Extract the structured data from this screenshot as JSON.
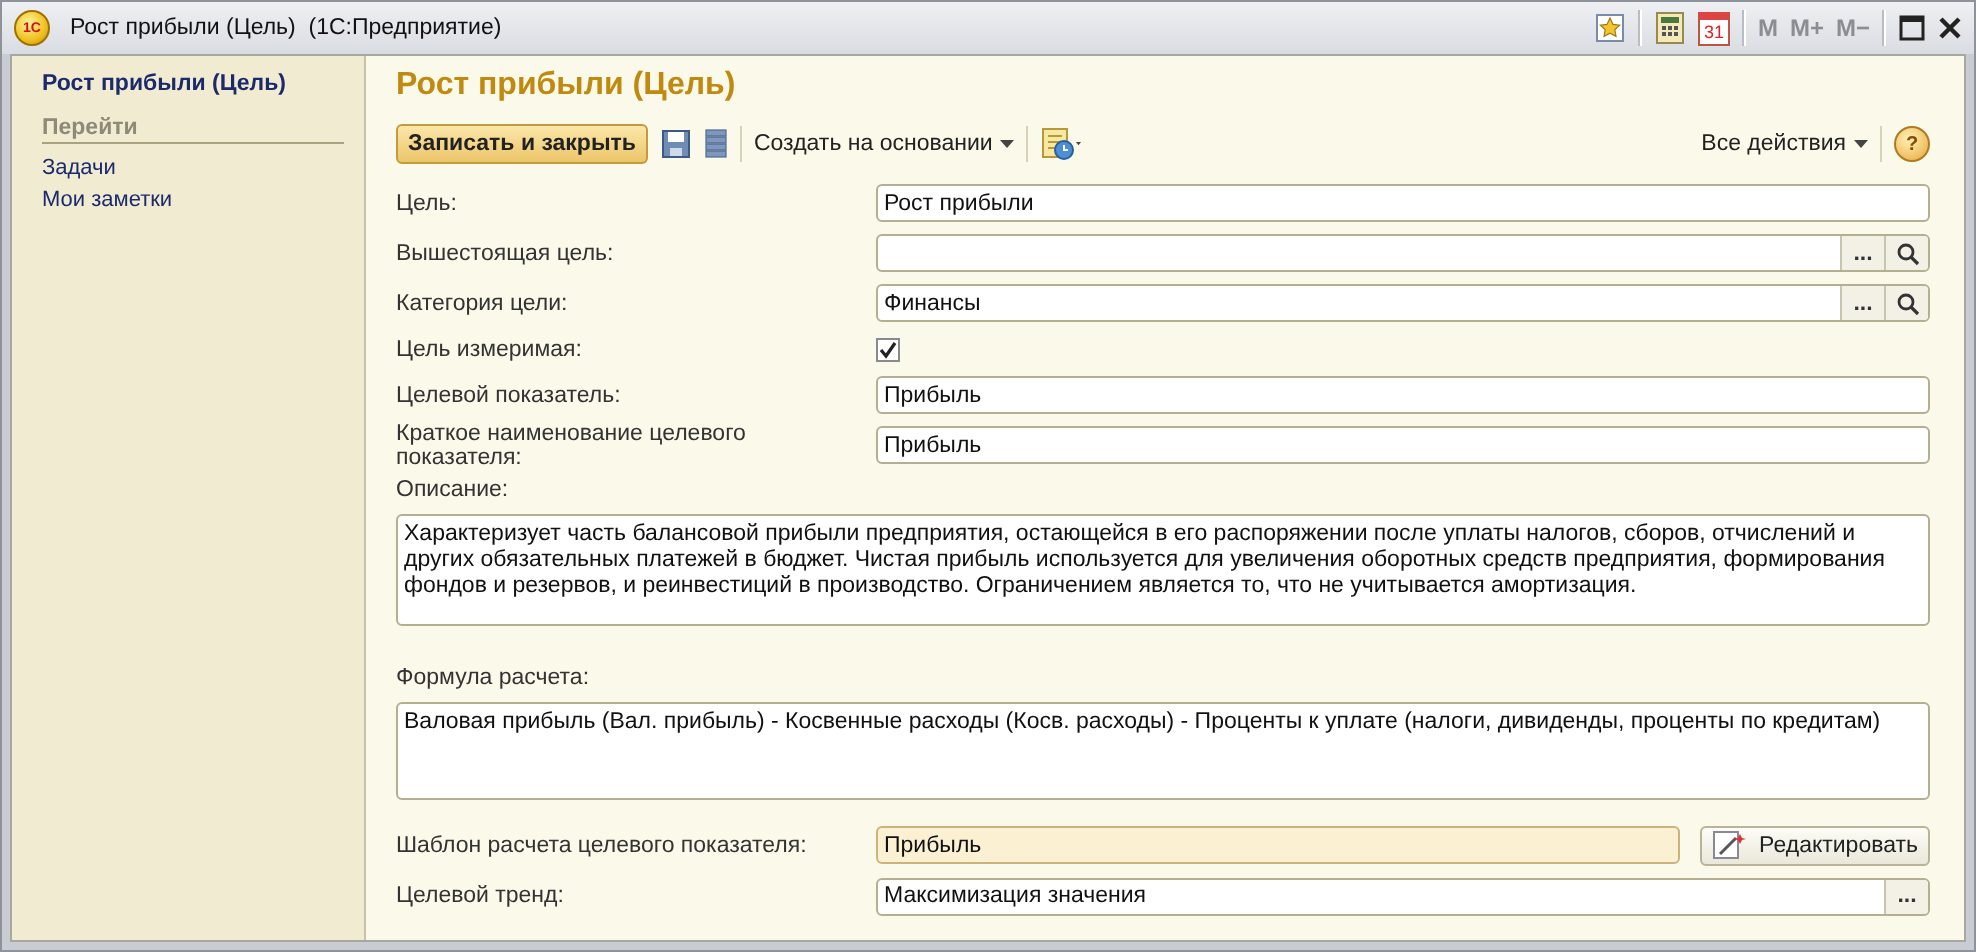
{
  "window": {
    "title": "Рост прибыли (Цель)  (1С:Предприятие)",
    "app_icon": "1С",
    "calendar_day": "31",
    "memory_buttons": [
      {
        "label": "M",
        "disabled": true
      },
      {
        "label": "M+",
        "disabled": true
      },
      {
        "label": "M−",
        "disabled": true
      }
    ]
  },
  "sidebar": {
    "title": "Рост прибыли (Цель)",
    "section": "Перейти",
    "items": [
      "Задачи",
      "Мои заметки"
    ]
  },
  "form": {
    "title": "Рост прибыли (Цель)",
    "toolbar": {
      "primary": "Записать и закрыть",
      "create_based_on": "Создать на основании",
      "all_actions": "Все действия",
      "help": "?"
    },
    "fields": [
      {
        "kind": "text",
        "label": "Цель:",
        "value": "Рост прибыли"
      },
      {
        "kind": "lookup",
        "label": "Вышестоящая цель:",
        "choose": "..."
      },
      {
        "kind": "lookup",
        "label": "Категория цели:",
        "value": "Финансы",
        "choose": "..."
      },
      {
        "kind": "checkbox",
        "label": "Цель измеримая:",
        "checked": true
      },
      {
        "kind": "text",
        "label": "Целевой показатель:",
        "value": "Прибыль"
      },
      {
        "kind": "text",
        "label": "Краткое наименование целевого показателя:",
        "value": "Прибыль"
      },
      {
        "kind": "memo",
        "label": "Описание:",
        "value": "Характеризует часть балансовой прибыли предприятия, остающейся в его распоряжении после уплаты налогов, сборов, отчислений и других обязательных платежей в бюджет.  Чистая прибыль используется для увеличения оборотных средств предприятия, формирования фондов и резервов, и реинвестиций в производство. Ограничением является то, что не учитывается амортизация."
      },
      {
        "kind": "memo",
        "label": "Формула расчета:",
        "value": "Валовая прибыль (Вал. прибыль) - Косвенные расходы (Косв. расходы) - Проценты к уплате (налоги, дивиденды, проценты по кредитам)"
      },
      {
        "kind": "template",
        "label": "Шаблон расчета целевого показателя:",
        "value": "Прибыль",
        "button": "Редактировать"
      },
      {
        "kind": "choice",
        "label": "Целевой тренд:",
        "value": "Максимизация значения",
        "choose": "..."
      }
    ]
  }
}
